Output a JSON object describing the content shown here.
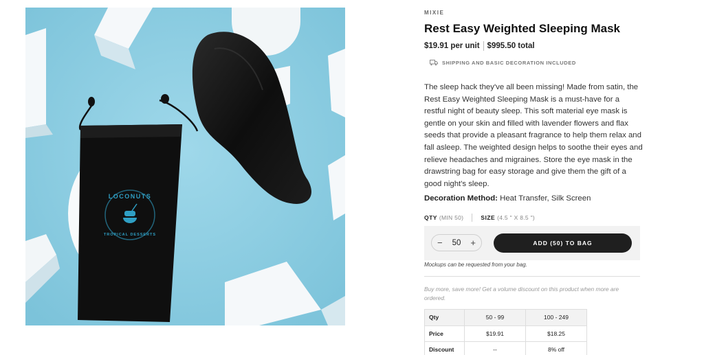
{
  "product": {
    "brand": "MIXIE",
    "title": "Rest Easy Weighted Sleeping Mask",
    "unit_price": "$19.91 per unit",
    "total_price": "$995.50 total",
    "shipping_note": "SHIPPING AND BASIC DECORATION INCLUDED",
    "description": "The sleep hack they've all been missing! Made from satin, the Rest Easy Weighted Sleeping Mask is a must-have for a restful night of beauty sleep. This soft material eye mask is gentle on your skin and filled with lavender flowers and flax seeds that provide a pleasant fragrance to help them relax and fall asleep. The weighted design helps to soothe their eyes and relieve headaches and migraines. Store the eye mask in the drawstring bag for easy storage and give them the gift of a good night's sleep.",
    "decoration_label": "Decoration Method:",
    "decoration_value": "Heat Transfer, Silk Screen",
    "image_logo_text": "LOCONUTS · TROPICAL DESSERTS"
  },
  "options": {
    "qty_label": "QTY",
    "qty_hint": "(MIN 50)",
    "size_label": "SIZE",
    "size_hint": "(4.5 \" X 8.5 \")"
  },
  "purchase": {
    "decrement": "−",
    "quantity": "50",
    "increment": "+",
    "add_button": "ADD (50) TO BAG",
    "mockup_note": "Mockups can be requested from your bag."
  },
  "volume": {
    "note": "Buy more, save more! Get a volume discount on this product when more are ordered.",
    "rows": [
      {
        "label": "Qty",
        "values": [
          "50 - 99",
          "100 - 249"
        ]
      },
      {
        "label": "Price",
        "values": [
          "$19.91",
          "$18.25"
        ]
      },
      {
        "label": "Discount",
        "values": [
          "--",
          "8% off"
        ]
      }
    ]
  },
  "colors": {
    "photo_background": "#8fcfe3",
    "button_background": "#1f1f1f",
    "logo_blue": "#2f9fc4"
  },
  "icons": [
    "truck-icon"
  ]
}
